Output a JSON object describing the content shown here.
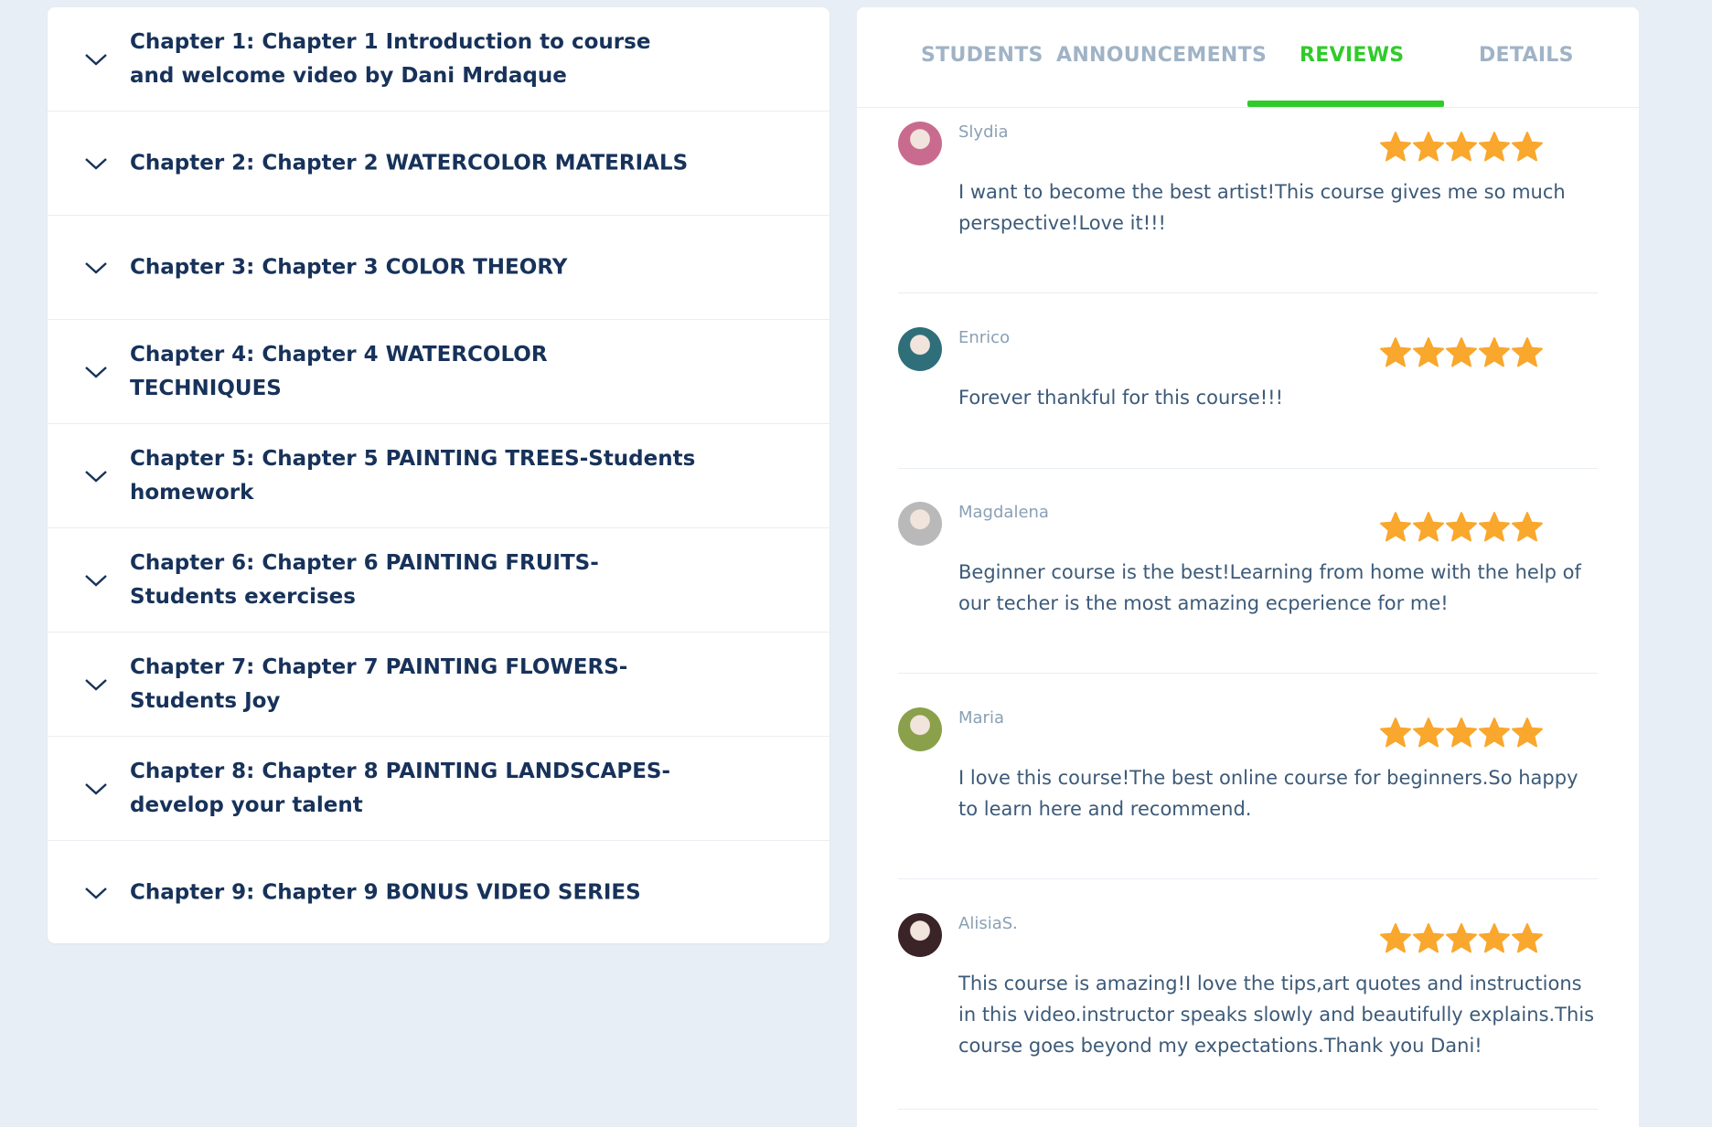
{
  "chapters": [
    {
      "title": "Chapter 1: Chapter 1 Introduction to course and welcome video by Dani Mrdaque"
    },
    {
      "title": "Chapter 2: Chapter 2 WATERCOLOR MATERIALS"
    },
    {
      "title": "Chapter 3: Chapter 3 COLOR THEORY"
    },
    {
      "title": "Chapter 4: Chapter 4 WATERCOLOR TECHNIQUES"
    },
    {
      "title": "Chapter 5: Chapter 5 PAINTING TREES-Students homework"
    },
    {
      "title": "Chapter 6: Chapter 6 PAINTING FRUITS-Students exercises"
    },
    {
      "title": "Chapter 7: Chapter 7 PAINTING FLOWERS-Students Joy"
    },
    {
      "title": "Chapter 8: Chapter 8 PAINTING LANDSCAPES-develop your talent"
    },
    {
      "title": "Chapter 9: Chapter 9 BONUS VIDEO SERIES"
    }
  ],
  "tabs": {
    "students": "STUDENTS",
    "announcements": "ANNOUNCEMENTS",
    "reviews": "REVIEWS",
    "details": "DETAILS",
    "active": "reviews"
  },
  "reviews": [
    {
      "name": "Slydia",
      "rating": 5,
      "text": "I want to become the best artist!This course gives me so much perspective!Love it!!!",
      "avatar_color": "#c96b8e"
    },
    {
      "name": "Enrico",
      "rating": 5,
      "text": "Forever thankful for this course!!!",
      "avatar_color": "#2f6f7a"
    },
    {
      "name": "Magdalena",
      "rating": 5,
      "text": "Beginner course is the best!Learning from home with the help of our techer is the most amazing ecperience for me!",
      "avatar_color": "#b9b9b9"
    },
    {
      "name": "Maria",
      "rating": 5,
      "text": "I love this course!The best online course for beginners.So happy to learn here and recommend.",
      "avatar_color": "#8aa04a"
    },
    {
      "name": "AlisiaS.",
      "rating": 5,
      "text": "This course is amazing!I love the tips,art quotes and instructions in this video.instructor speaks slowly and beautifully explains.This course goes beyond my expectations.Thank you Dani!",
      "avatar_color": "#3a2428"
    }
  ],
  "colors": {
    "chapter_title": "#17325a",
    "tab_inactive": "#a0b3c6",
    "tab_active": "#2fcb2a",
    "star": "#f9a72d",
    "review_text": "#3c5a78",
    "reviewer_name": "#8aa0b4"
  }
}
